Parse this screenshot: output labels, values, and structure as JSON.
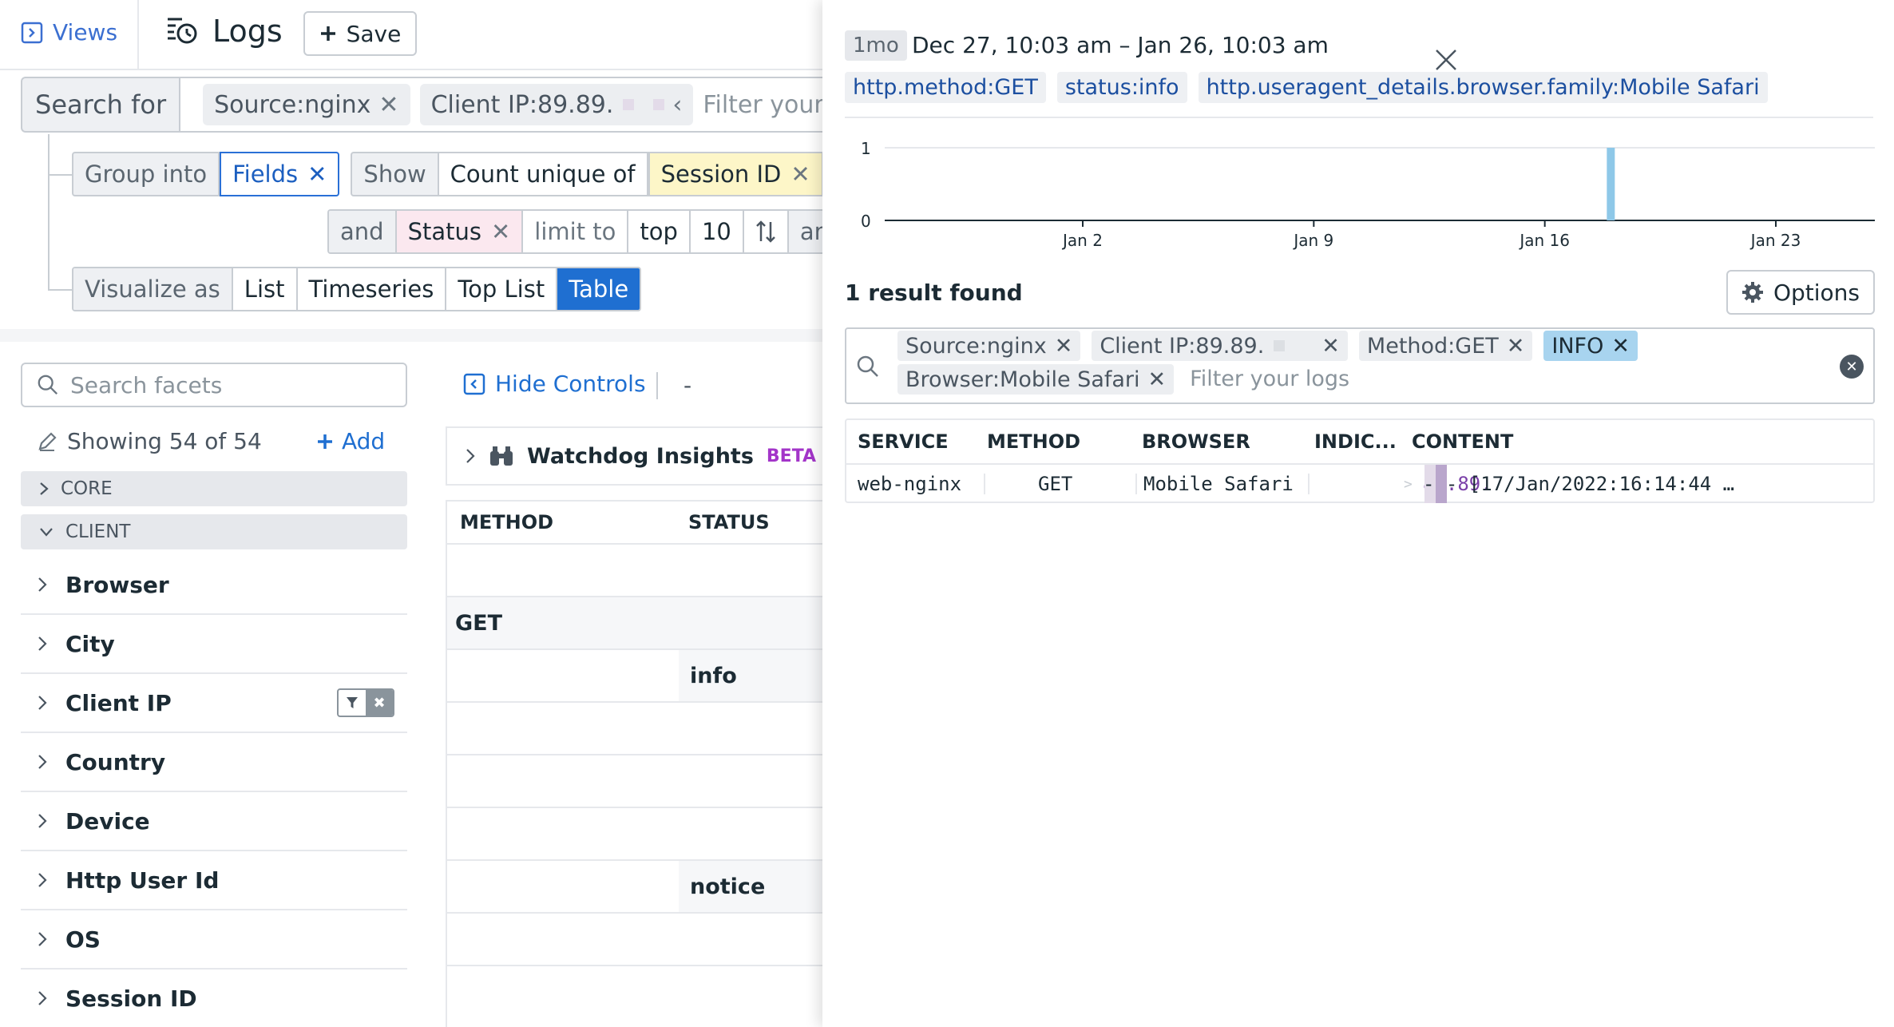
{
  "nav": {
    "views_label": "Views",
    "logs_title": "Logs",
    "save_label": "Save"
  },
  "search": {
    "prefix": "Search for",
    "chips": [
      "Source:nginx",
      "Client IP:89.89."
    ],
    "placeholder": "Filter your"
  },
  "group": {
    "group_into": "Group into",
    "fields": "Fields",
    "show": "Show",
    "count_unique_of": "Count unique of",
    "session_id": "Session ID",
    "and1": "and",
    "and2": "and",
    "status": "Status",
    "limit_to": "limit to",
    "top": "top",
    "limit": "10",
    "and3": "and"
  },
  "visualize": {
    "label": "Visualize as",
    "options": [
      "List",
      "Timeseries",
      "Top List",
      "Table"
    ],
    "active": "Table"
  },
  "facets": {
    "search_placeholder": "Search facets",
    "showing": "Showing 54 of 54",
    "add": "Add",
    "categories": [
      "CORE",
      "CLIENT"
    ],
    "items": [
      "Browser",
      "City",
      "Client IP",
      "Country",
      "Device",
      "Http User Id",
      "OS",
      "Session ID"
    ]
  },
  "middle": {
    "hide_controls": "Hide Controls",
    "dash": "-",
    "watchdog": "Watchdog Insights",
    "beta": "BETA",
    "columns": [
      "METHOD",
      "STATUS"
    ],
    "rows": [
      {
        "method": "",
        "status": ""
      },
      {
        "method": "GET",
        "status": ""
      },
      {
        "method": "",
        "status": "info"
      },
      {
        "method": "",
        "status": ""
      },
      {
        "method": "",
        "status": ""
      },
      {
        "method": "",
        "status": ""
      },
      {
        "method": "",
        "status": "notice"
      },
      {
        "method": "",
        "status": ""
      }
    ]
  },
  "panel": {
    "time_badge": "1mo",
    "time_range": "Dec 27, 10:03 am – Jan 26, 10:03 am",
    "query_chips": [
      "http.method:GET",
      "status:info",
      "http.useragent_details.browser.family:Mobile Safari"
    ],
    "result_count": "1 result found",
    "options_label": "Options",
    "filter_chips": [
      "Source:nginx",
      "Client IP:89.89.",
      "Method:GET",
      "INFO",
      "Browser:Mobile Safari"
    ],
    "filter_placeholder": "Filter your logs",
    "columns": [
      "SERVICE",
      "METHOD",
      "BROWSER",
      "INDIC...",
      "CONTENT"
    ],
    "log_row": {
      "service": "web-nginx",
      "method": "GET",
      "browser": "Mobile Safari",
      "indicator": "",
      "content_ip": "89.89.",
      "content_rest": "- - [17/Jan/2022:16:14:44 …"
    }
  },
  "chart_data": {
    "type": "bar",
    "x_ticks": [
      "Jan 2",
      "Jan 9",
      "Jan 16",
      "Jan 23"
    ],
    "y_ticks": [
      "1",
      "0"
    ],
    "ylim": [
      0,
      1
    ],
    "bars": [
      {
        "x": "Jan 18",
        "value": 1
      }
    ],
    "color": "#8ec8e8"
  }
}
